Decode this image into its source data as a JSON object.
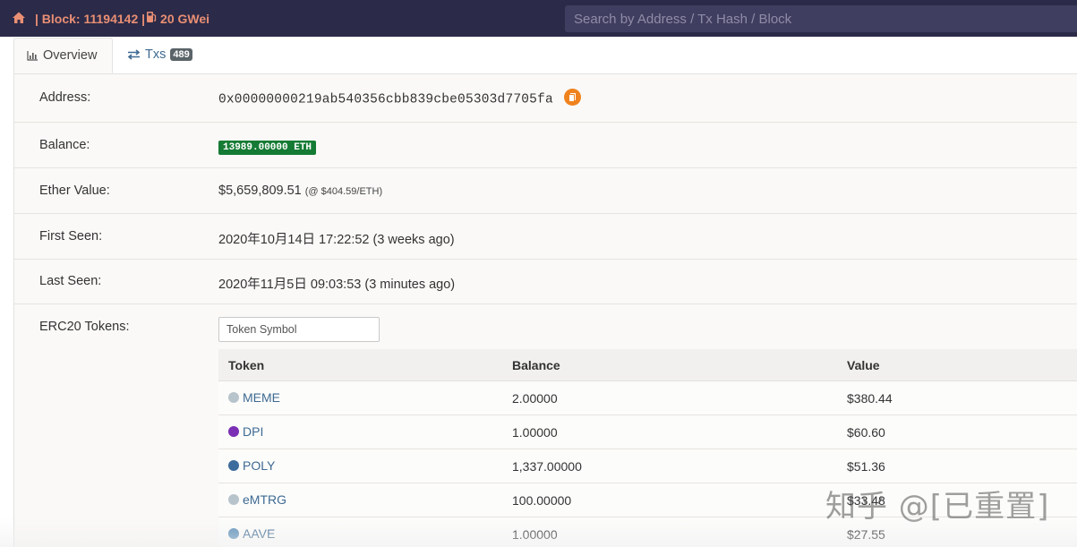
{
  "header": {
    "block_text": "| Block: 11194142 |",
    "gas_text": "20 GWei",
    "search_placeholder": "Search by Address / Tx Hash / Block",
    "home_icon": "home-icon",
    "gas_icon": "gas-pump-icon"
  },
  "tabs": [
    {
      "label": "Overview",
      "icon": "bar-chart-icon"
    },
    {
      "label": "Txs",
      "icon": "exchange-arrows-icon",
      "count": "489"
    }
  ],
  "overview": {
    "address_label": "Address:",
    "address_value": "0x00000000219ab540356cbb839cbe05303d7705fa",
    "balance_label": "Balance:",
    "balance_value": "13989.00000 ETH",
    "ether_value_label": "Ether Value:",
    "ether_value": "$5,659,809.51",
    "ether_rate": "(@ $404.59/ETH)",
    "first_seen_label": "First Seen:",
    "first_seen_value": "2020年10月14日 17:22:52 (3 weeks ago)",
    "last_seen_label": "Last Seen:",
    "last_seen_value": "2020年11月5日 09:03:53 (3 minutes ago)",
    "erc20_label": "ERC20 Tokens:",
    "token_filter_placeholder": "Token Symbol"
  },
  "tokens": {
    "headers": [
      "Token",
      "Balance",
      "Value"
    ],
    "rows": [
      {
        "symbol": "MEME",
        "balance": "2.00000",
        "value": "$380.44",
        "icon_color": "#b8c4cc"
      },
      {
        "symbol": "DPI",
        "balance": "1.00000",
        "value": "$60.60",
        "icon_color": "#7a2fb4"
      },
      {
        "symbol": "POLY",
        "balance": "1,337.00000",
        "value": "$51.36",
        "icon_color": "#3d6c9c"
      },
      {
        "symbol": "eMTRG",
        "balance": "100.00000",
        "value": "$33.48",
        "icon_color": "#b8c4cc"
      },
      {
        "symbol": "AAVE",
        "balance": "1.00000",
        "value": "$27.55",
        "icon_color": "#5a8fb8"
      }
    ]
  },
  "watermark": "知乎 @[已重置]",
  "colors": {
    "topbar": "#2b2a48",
    "accent": "#e98f74",
    "link": "#3e6a92",
    "eth_badge": "#157b34",
    "copy_button": "#f0821e"
  }
}
